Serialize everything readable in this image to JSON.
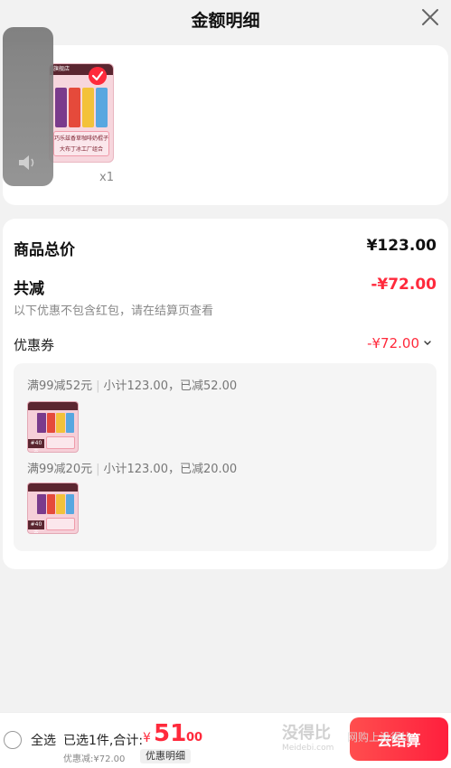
{
  "header": {
    "title": "金额明细"
  },
  "product": {
    "qty": "x1",
    "thumb_store": "旗舰店",
    "thumb_caption_1": "巧乐兹香草咖啡奶棍子",
    "thumb_caption_2": "大布丁冰工厂组合"
  },
  "summary": {
    "total_label": "商品总价",
    "total_value": "¥123.00",
    "reduce_label": "共减",
    "reduce_value": "-¥72.00",
    "note": "以下优惠不包含红包，请在结算页查看"
  },
  "coupon": {
    "label": "优惠券",
    "value": "-¥72.00",
    "items": [
      {
        "rule": "满99减52元",
        "subtotal": "小计123.00，已减52.00",
        "tag": "#40支"
      },
      {
        "rule": "满99减20元",
        "subtotal": "小计123.00，已减20.00",
        "tag": "#40支"
      }
    ]
  },
  "footer": {
    "select_all": "全选",
    "selected_text": "已选1件,合计:",
    "currency": "¥",
    "amount_int": "51",
    "amount_dec": ".00",
    "discount_text": "优惠减:¥72.00",
    "detail_button": "优惠明细",
    "checkout_button": "去结算"
  },
  "watermark": {
    "line1": "没得比",
    "line2": "Meidebi.com",
    "line3": "网购上没得比"
  },
  "colors": {
    "accent": "#ff2a3c",
    "card": "#ffffff",
    "background": "#f2f2f2"
  }
}
